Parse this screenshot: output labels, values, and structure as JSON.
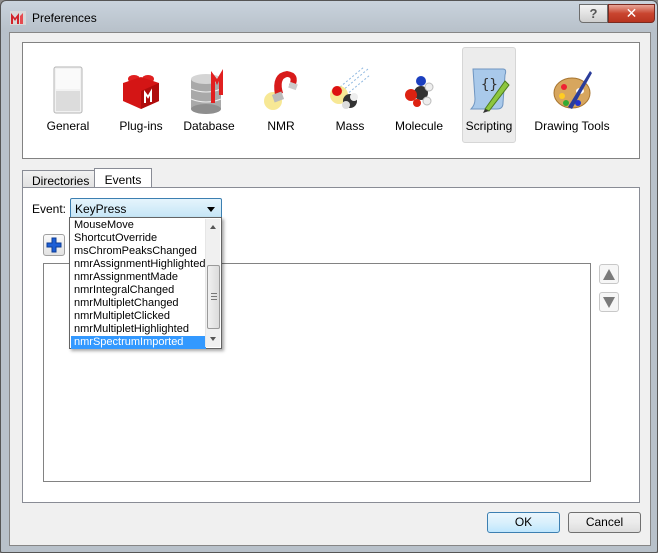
{
  "window": {
    "title": "Preferences",
    "help_label": "?",
    "close_label": "✕"
  },
  "categories": [
    {
      "label": "General",
      "icon": "general-icon"
    },
    {
      "label": "Plug-ins",
      "icon": "plugin-brick-icon"
    },
    {
      "label": "Database",
      "icon": "database-icon"
    },
    {
      "label": "NMR",
      "icon": "magnet-icon"
    },
    {
      "label": "Mass",
      "icon": "mass-spec-icon"
    },
    {
      "label": "Molecule",
      "icon": "molecule-icon"
    },
    {
      "label": "Scripting",
      "icon": "script-scroll-icon",
      "selected": true
    },
    {
      "label": "Drawing Tools",
      "icon": "palette-icon"
    }
  ],
  "tabs": [
    {
      "label": "Directories",
      "active": false
    },
    {
      "label": "Events",
      "active": true
    }
  ],
  "events": {
    "label": "Event:",
    "selected": "KeyPress",
    "options": [
      "MouseMove",
      "ShortcutOverride",
      "msChromPeaksChanged",
      "nmrAssignmentHighlighted",
      "nmrAssignmentMade",
      "nmrIntegralChanged",
      "nmrMultipletChanged",
      "nmrMultipletClicked",
      "nmrMultipletHighlighted",
      "nmrSpectrumImported"
    ],
    "highlighted": "nmrSpectrumImported"
  },
  "buttons": {
    "ok": "OK",
    "cancel": "Cancel"
  }
}
